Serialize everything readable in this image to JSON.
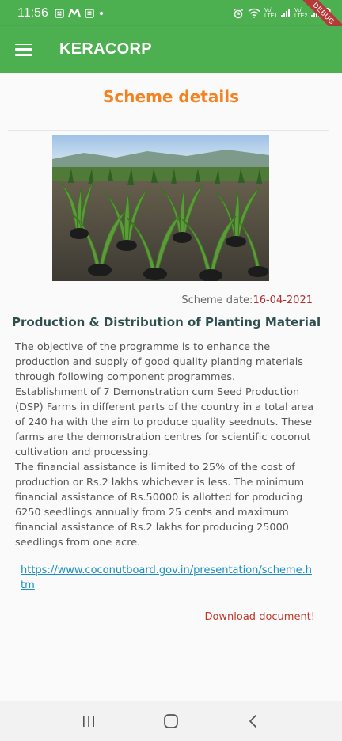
{
  "status_bar": {
    "time": "11:56",
    "left_icons": [
      "notification-icon",
      "messenger-icon",
      "notification-icon",
      "dot-icon"
    ],
    "right_icons": [
      "alarm-icon",
      "wifi-icon",
      "signal-lte1-icon",
      "signal-lte2-icon",
      "battery-icon"
    ],
    "lte1_label": "Vo) LTE1",
    "lte2_label": "Vo) LTE2",
    "debug_label": "DEBUG"
  },
  "app_bar": {
    "title": "KERACORP",
    "menu_icon": "hamburger-menu-icon",
    "background_color": "#4caf50"
  },
  "page": {
    "heading": "Scheme details",
    "heading_color": "#f58220",
    "scheme_date_label": "Scheme date:",
    "scheme_date_value": "16-04-2021",
    "title": "Production & Distribution of Planting Material",
    "description": " The objective of the programme is to enhance the production and supply of good quality planting materials through following component programmes.\nEstablishment of 7 Demonstration cum Seed Production (DSP) Farms in different parts of the country in a total area of 240 ha with the aim to produce quality seednuts. These farms are the demonstration centres for scientific coconut cultivation and processing.\nThe financial assistance is limited to 25% of the cost of production or Rs.2 lakhs whichever is less. The minimum financial assistance of Rs.50000 is allotted for producing 6250 seedlings annually from 25 cents and maximum financial assistance of Rs.2 lakhs for producing 25000 seedlings from one acre.",
    "link": "https://www.coconutboard.gov.in/presentation/scheme.htm",
    "download_label": "Download document!"
  },
  "nav_bar": {
    "recents_icon": "recent-apps-icon",
    "home_icon": "home-icon",
    "back_icon": "back-icon"
  }
}
